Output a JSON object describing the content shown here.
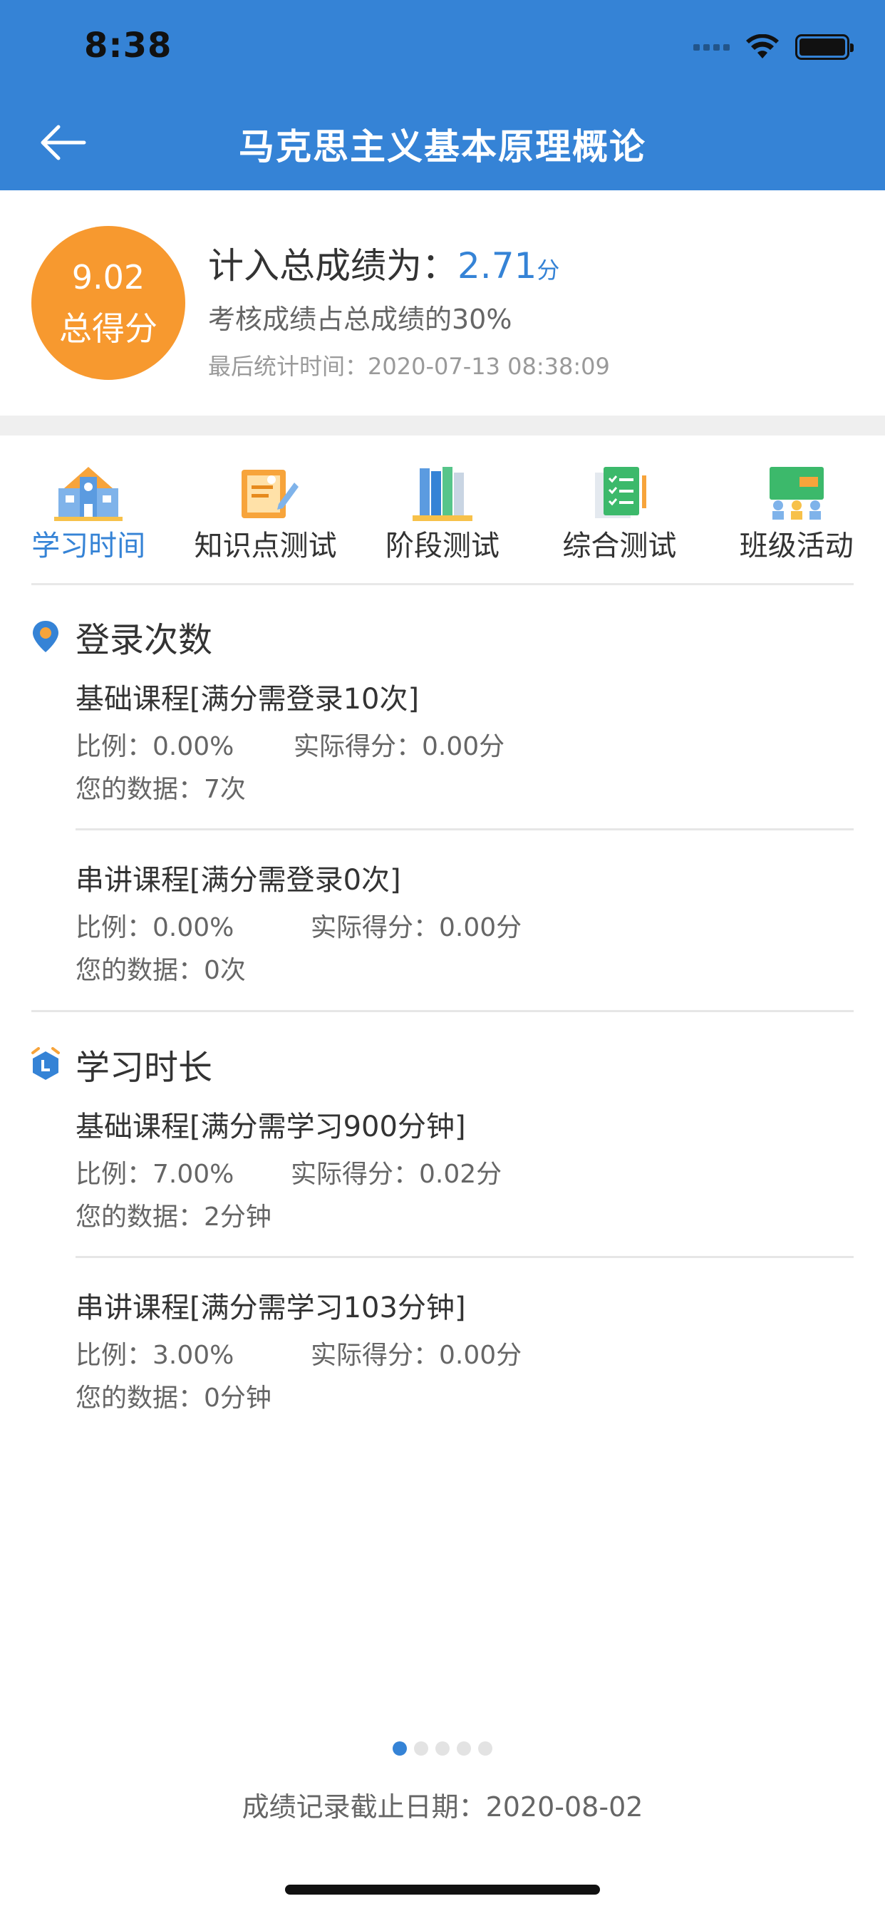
{
  "status_bar": {
    "time": "8:38"
  },
  "header": {
    "title": "马克思主义基本原理概论"
  },
  "score": {
    "total_value": "9.02",
    "total_label": "总得分",
    "counted_label": "计入总成绩为：",
    "counted_value": "2.71",
    "counted_unit": "分",
    "ratio_text": "考核成绩占总成绩的30%",
    "last_updated": "最后统计时间：2020-07-13 08:38:09"
  },
  "tabs": [
    {
      "label": "学习时间",
      "icon": "school-icon",
      "active": true
    },
    {
      "label": "知识点测试",
      "icon": "notepad-icon",
      "active": false
    },
    {
      "label": "阶段测试",
      "icon": "books-icon",
      "active": false
    },
    {
      "label": "综合测试",
      "icon": "checklist-icon",
      "active": false
    },
    {
      "label": "班级活动",
      "icon": "classroom-icon",
      "active": false
    }
  ],
  "sections": [
    {
      "title": "登录次数",
      "icon": "location-pin-icon",
      "items": [
        {
          "title": "基础课程[满分需登录10次]",
          "ratio": "比例：0.00%",
          "score": "实际得分：0.00分",
          "data": "您的数据：7次"
        },
        {
          "title": "串讲课程[满分需登录0次]",
          "ratio": "比例：0.00%",
          "score": "实际得分：0.00分",
          "data": "您的数据：0次"
        }
      ]
    },
    {
      "title": "学习时长",
      "icon": "alarm-clock-icon",
      "items": [
        {
          "title": "基础课程[满分需学习900分钟]",
          "ratio": "比例：7.00%",
          "score": "实际得分：0.02分",
          "data": "您的数据：2分钟"
        },
        {
          "title": "串讲课程[满分需学习103分钟]",
          "ratio": "比例：3.00%",
          "score": "实际得分：0.00分",
          "data": "您的数据：0分钟"
        }
      ]
    }
  ],
  "pagination": {
    "total": 5,
    "current": 1
  },
  "footer": {
    "date_text": "成绩记录截止日期：2020-08-02"
  },
  "colors": {
    "accent": "#3583d6",
    "score_circle": "#f7992f"
  }
}
